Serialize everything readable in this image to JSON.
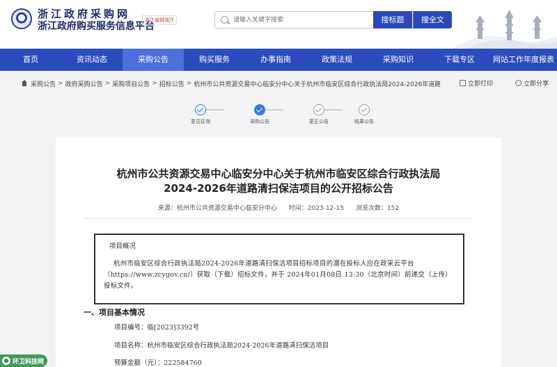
{
  "header": {
    "title": "浙江政府采购网",
    "subtitle": "浙江政府购买服务信息平台",
    "tag": "浙江省财政厅",
    "search_placeholder": "请输入关键字搜索",
    "btn_title_search": "搜标题",
    "btn_full_search": "搜全文"
  },
  "nav": [
    "首页",
    "资讯动态",
    "采购公告",
    "购买服务",
    "办事指南",
    "政策法规",
    "采购知识",
    "下载专区",
    "网站工作年度报表"
  ],
  "nav_active": 2,
  "breadcrumb": {
    "items": [
      "采购公告",
      "政府采购公告",
      "采购项目公告",
      "招标公告"
    ],
    "current": "杭州市公共资源交易中心临安分中心关于杭州市临安区综合行政执法局2024-2026年道路清扫",
    "print": "立即打印",
    "share": "立即分享"
  },
  "steps": [
    {
      "label": "意见征询",
      "state": "done"
    },
    {
      "label": "采购公告",
      "state": "current"
    },
    {
      "label": "更正公告",
      "state": "pending"
    },
    {
      "label": "结果公告",
      "state": "pending"
    }
  ],
  "article": {
    "title_line1": "杭州市公共资源交易中心临安分中心关于杭州市临安区综合行政执法局",
    "title_line2": "2024-2026年道路清扫保洁项目的公开招标公告",
    "source": "来源：杭州市公共资源交易中心临安分中心",
    "date": "时间：2023-12-15",
    "views": "浏览次数：152",
    "overview_title": "项目概况",
    "overview_text": "杭州市临安区综合行政执法局2024-2026年道路清扫保洁项目招标项目的潜在投标人应在政采云平台（https://www.zcygov.cn/）获取（下载）招标文件，并于 2024年01月08日 13:30（北京时间）前递交（上传）投标文件。",
    "section1": "一、项目基本情况",
    "project_no": "项目编号：临[2023]3392号",
    "project_name": "项目名称：杭州市临安区综合行政执法局2024-2026年道路清扫保洁项目",
    "budget": "预算金额（元）：222584760"
  },
  "watermark": "环卫科技网",
  "colors": {
    "nav_bg": "#2c4bbd",
    "nav_active": "#4f6edb",
    "accent": "#2b48b9",
    "step": "#3b7bd4"
  }
}
